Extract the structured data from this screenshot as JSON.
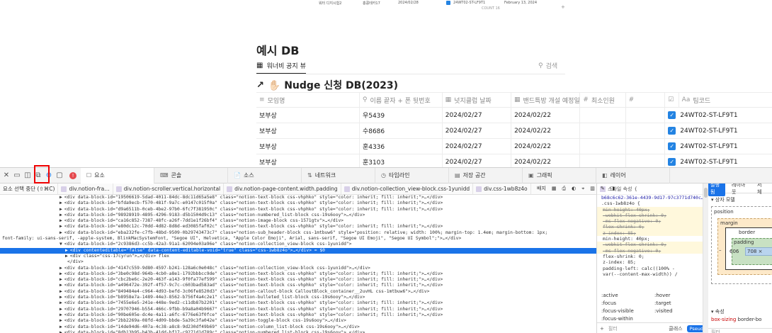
{
  "mini_table": {
    "rows": [
      {
        "a": "워터 디지시험2",
        "b": "홍콩테카17",
        "c": "2024/02/28",
        "code": "24WT02-ST-LF9T1",
        "date": "February 13, 2024"
      }
    ],
    "count": "COUNT 16"
  },
  "notion": {
    "page_title": "예시 DB",
    "view_tab": "워너비 공지 뷰",
    "search_placeholder": "검색",
    "db_title": "✋🏻 Nudge 신청 DB(2023)",
    "columns": [
      {
        "icon": "≡",
        "label": "모임명"
      },
      {
        "icon": "⚲",
        "label": "이름 끝자 + 폰 뒷번호"
      },
      {
        "icon": "▦",
        "label": "넛지클럽 날짜"
      },
      {
        "icon": "▦",
        "label": "밴드특방 개설 예정일"
      },
      {
        "icon": "#",
        "label": "최소인원"
      },
      {
        "icon": "#",
        "label": ""
      },
      {
        "icon": "☑",
        "label": ""
      },
      {
        "icon": "Aa",
        "label": "팀코드"
      }
    ],
    "rows": [
      {
        "name": "보부상",
        "person": "우5439",
        "nudge_date": "2024/02/27",
        "band_date": "2024/02/22",
        "min": "",
        "num": "",
        "checked": true,
        "code": "24WT02-ST-LF9T1"
      },
      {
        "name": "보부상",
        "person": "수8686",
        "nudge_date": "2024/02/27",
        "band_date": "2024/02/22",
        "min": "",
        "num": "",
        "checked": true,
        "code": "24WT02-ST-LF9T1"
      },
      {
        "name": "보부상",
        "person": "훈4336",
        "nudge_date": "2024/02/27",
        "band_date": "2024/02/22",
        "min": "",
        "num": "",
        "checked": true,
        "code": "24WT02-ST-LF9T1"
      },
      {
        "name": "보부상",
        "person": "훈3103",
        "nudge_date": "2024/02/27",
        "band_date": "2024/02/22",
        "min": "",
        "num": "",
        "checked": true,
        "code": "24WT02-ST-LF9T1"
      }
    ]
  },
  "devtools": {
    "tabs": [
      {
        "icon": "☐",
        "label": "요소"
      },
      {
        "icon": "⌨",
        "label": "콘솔"
      },
      {
        "icon": "📄",
        "label": "소스"
      },
      {
        "icon": "⇅",
        "label": "네트워크"
      },
      {
        "icon": "◷",
        "label": "타임라인"
      },
      {
        "icon": "▤",
        "label": "저장 공간"
      },
      {
        "icon": "▣",
        "label": "그래픽"
      },
      {
        "icon": "◧",
        "label": "레이어"
      }
    ],
    "error_count": "!",
    "crumbs": [
      {
        "label": "요소 선택 중단 (⇧⌘C)",
        "dv": false
      },
      {
        "label": "div.notion-fra…",
        "dv": true
      },
      {
        "label": "div.notion-scroller.vertical.horizontal",
        "dv": true
      },
      {
        "label": "div.notion-page-content.width.padding",
        "dv": true
      },
      {
        "label": "div.notion-collection_view-block.css-1yunidd",
        "dv": true
      },
      {
        "label": "div.css-1wb8z4o",
        "dv": true
      }
    ],
    "crumb_right": {
      "badge": "배지"
    },
    "dom_lines": [
      {
        "indent": 84,
        "arrow": "▶",
        "text": "<div data-block-id=\"19506619-5dad-4011-84dc-8dc11d65a5e8\" class=\"notion-text-block css-vhphko\" style=\"color: inherit; fill: inherit;\">…</div>",
        "sel": false
      },
      {
        "indent": 84,
        "arrow": "▶",
        "text": "<div data-block-id=\"bfda9ecb-f570-481f-9a7c-e0147c015f0a\" class=\"notion-text-block css-vhphko\" style=\"color: inherit; fill: inherit;\">…</div>",
        "sel": false
      },
      {
        "indent": 84,
        "arrow": "▶",
        "text": "<div data-block-id=\"d9a6511b-0ceb-4be2-97b0-6fc7f381950c\" class=\"notion-text-block css-vhphko\" style=\"color: inherit; fill: inherit;\">…</div>",
        "sel": false
      },
      {
        "indent": 84,
        "arrow": "▶",
        "text": "<div data-block-id=\"98928919-4895-4296-9183-d5b1504d9c13\" class=\"notion-numbered_list-block css-19s6ooy\">…</div>",
        "sel": false
      },
      {
        "indent": 84,
        "arrow": "▶",
        "text": "<div data-block-id=\"ca16c852-7387-48fc-a26f-7dd1e1f26bf4\" class=\"notion-image-block css-1571gtv\">…</div>",
        "sel": false
      },
      {
        "indent": 84,
        "arrow": "▶",
        "text": "<div data-block-id=\"e80dc12c-70dd-4d82-8d8d-ed3085faf02c\" class=\"notion-text-block css-vhphko\" style=\"color: inherit; fill: inherit;\">…</div>",
        "sel": false
      },
      {
        "indent": 84,
        "arrow": "▶",
        "text": "<div data-block-id=\"eba232fe-c7fb-48bd-9509-0b29743473c7\" class=\"notion-sub_header-block css-1mtbuw6\" style=\"position: relative; width: 100%; margin-top: 1.4em; margin-bottom: 1px;",
        "sel": false
      },
      {
        "indent": 0,
        "arrow": "",
        "text": "font-family: ui-sans-serif, -apple-system, BlinkMacSystemFont, \"Segoe UI\", Helvetica, \"Apple Color Emoji\", Arial, sans-serif, \"Segoe UI Emoji\", \"Segoe UI Symbol\";\">…</div>",
        "sel": false
      },
      {
        "indent": 84,
        "arrow": "▼",
        "text": "<div data-block-id=\"2c9386d3-cc5b-42a3-91a1-62094e03a96e\" class=\"notion-collection_view-block css-1yunidd\">",
        "sel": false
      },
      {
        "indent": 92,
        "arrow": "▶",
        "text": "<div contenteditable=\"false\" data-content-editable-void=\"true\" class=\"css-1wb8z4o\">…</div> = $0",
        "sel": true
      },
      {
        "indent": 92,
        "arrow": "▶",
        "text": "<div class=\"css-17cyrun\">…</div>  flex",
        "sel": false
      },
      {
        "indent": 92,
        "arrow": "",
        "text": "</div>",
        "sel": false
      },
      {
        "indent": 84,
        "arrow": "▶",
        "text": "<div data-block-id=\"4147c559-9d80-4597-b241-128a6c0e048c\" class=\"notion-collection_view-block css-1yunidd\">…</div>",
        "sel": false
      },
      {
        "indent": 84,
        "arrow": "▶",
        "text": "<div data-block-id=\"3be0c98d-964b-4cb0-a8e1-1792bbbcc9de\" class=\"notion-text-block css-vhphko\" style=\"color: inherit; fill: inherit;\">…</div>",
        "sel": false
      },
      {
        "indent": 84,
        "arrow": "▶",
        "text": "<div data-block-id=\"cbc2be6c-2e20-463f-a143-9f0fa77ef599\" class=\"notion-text-block css-vhphko\" style=\"color: inherit; fill: inherit;\">…</div>",
        "sel": false
      },
      {
        "indent": 84,
        "arrow": "▶",
        "text": "<div data-block-id=\"a496472e-392f-4f57-9c7c-c603bad583ad\" class=\"notion-text-block css-vhphko\" style=\"color: inherit; fill: inherit;\">…</div>",
        "sel": false
      },
      {
        "indent": 84,
        "arrow": "▶",
        "text": "<div data-block-id=\"849484e4-c964-4d93-befd-3c06fe8520d3\" class=\"notion-callout-block CalloutBlock_container__2uvHL css-1mtbuw6\">…</div>",
        "sel": false
      },
      {
        "indent": 84,
        "arrow": "▶",
        "text": "<div data-block-id=\"b8958e7a-1489-44e3-8562-b756f4a4c2e1\" class=\"notion-bulleted_list-block css-19s6ooy\">…</div>",
        "sel": false
      },
      {
        "indent": 84,
        "arrow": "▶",
        "text": "<div data-block-id=\"7455e6e5-241e-448e-9ed2-c11db87b2201\" class=\"notion-text-block css-vhphko\" style=\"color: inherit; fill: inherit;\">…</div>",
        "sel": false
      },
      {
        "indent": 84,
        "arrow": "▶",
        "text": "<div data-block-id=\"29707946-b554-466c-9fbb-b9a8a04b9667\" class=\"notion-text-block css-vhphko\" style=\"color: inherit; fill: inherit;\">…</div>",
        "sel": false
      },
      {
        "indent": 84,
        "arrow": "▶",
        "text": "<div data-block-id=\"90be605e-dc4e-4a11-a6fc-6776e63f0fce\" class=\"notion-text-block css-vhphko\" style=\"color: inherit; fill: inherit;\">…</div>",
        "sel": false
      },
      {
        "indent": 84,
        "arrow": "▶",
        "text": "<div data-block-id=\"2bb2269a-08fd-4d09-bbde-5a39c3fa042e\" class=\"notion-toggle-block css-19s6ooy\">…</div>",
        "sel": false
      },
      {
        "indent": 84,
        "arrow": "▶",
        "text": "<div data-block-id=\"14de94d6-407a-4c38-a8c8-9d230df49b69\" class=\"notion-column_list-block css-19s6ooy\">…</div>",
        "sel": false
      },
      {
        "indent": 84,
        "arrow": "▶",
        "text": "<div data-block-id=\"8db13b95-b43b-41dd-bf17-c9271d1d789c\" class=\"notion-numbered_list-block css-19s6ooy\">…</div>",
        "sel": false
      }
    ],
    "styles": {
      "header": "스타일 속성",
      "source_link": "b68c6c62-361e-4439-9d17-97c3771d740c…",
      "selector": ".css-1wb8z4o {",
      "lines": [
        {
          "text": "min-height: 40px;",
          "strike": true
        },
        {
          "text": "-webkit-flex-shrink: 0;",
          "strike": true
        },
        {
          "text": "-ms-flex-negative: 0;",
          "strike": true
        },
        {
          "text": "flex-shrink: 0;",
          "strike": true
        },
        {
          "text": "z-index: 85;",
          "strike": true
        },
        {
          "text": "min-height: 40px;",
          "strike": false
        },
        {
          "text": "-webkit-flex-shrink: 0;",
          "strike": true
        },
        {
          "text": "-ms-flex-negative: 0;",
          "strike": true
        },
        {
          "text": "flex-shrink: 0;",
          "strike": false
        },
        {
          "text": "z-index: 85;",
          "strike": false
        },
        {
          "text": "padding-left: calc((100% -",
          "strike": false
        },
        {
          "text": "var(--content-max-width)) /",
          "strike": false
        }
      ],
      "pseudo": [
        [
          ":active",
          ":hover"
        ],
        [
          ":focus",
          ":target"
        ],
        [
          ":focus-visible",
          ":visited"
        ],
        [
          ":focus-within",
          ""
        ]
      ],
      "filter_placeholder": "필터",
      "class_btn": "클래스",
      "pseudo_btn": "Pseudo"
    },
    "layout": {
      "tabs": [
        "실행됨",
        "레이아웃",
        "서체"
      ],
      "section": "상자 모델",
      "position": "position",
      "margin": "margin",
      "border": "border",
      "padding": "padding",
      "width": "606",
      "content": "708 ×",
      "dash": "–",
      "props_title": "속성",
      "box_sizing": "box-sizing",
      "box_sizing_val": "border-bo",
      "filter": "필터"
    }
  }
}
